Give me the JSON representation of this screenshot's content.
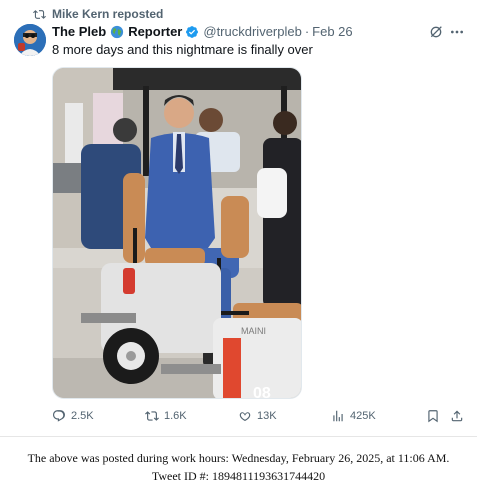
{
  "repost": {
    "label": "Mike Kern reposted"
  },
  "author": {
    "name_first": "The Pleb",
    "name_second": "Reporter",
    "handle": "@truckdriverpleb",
    "date": "Feb 26"
  },
  "post": {
    "text": "8 more days and this nightmare is finally over"
  },
  "icons": {
    "repost_header": "repost-icon",
    "globe": "globe-emoji-icon",
    "verified": "verified-badge-icon",
    "grok": "grok-icon",
    "more": "more-icon",
    "reply": "reply-icon",
    "retweet": "retweet-icon",
    "like": "heart-icon",
    "views": "views-icon",
    "bookmark": "bookmark-icon",
    "share": "share-icon"
  },
  "stats": {
    "replies": "2.5K",
    "reposts": "1.6K",
    "likes": "13K",
    "views": "425K"
  },
  "media": {
    "cart_brand": "MAINI",
    "cart_number": "08"
  },
  "colors": {
    "verified": "#1d9bf0",
    "secondary_text": "#536471"
  },
  "caption": {
    "line1": "The above was posted during work hours: Wednesday, February 26, 2025, at 11:06 AM.",
    "line2": "Tweet ID #: 1894811193631744420"
  }
}
